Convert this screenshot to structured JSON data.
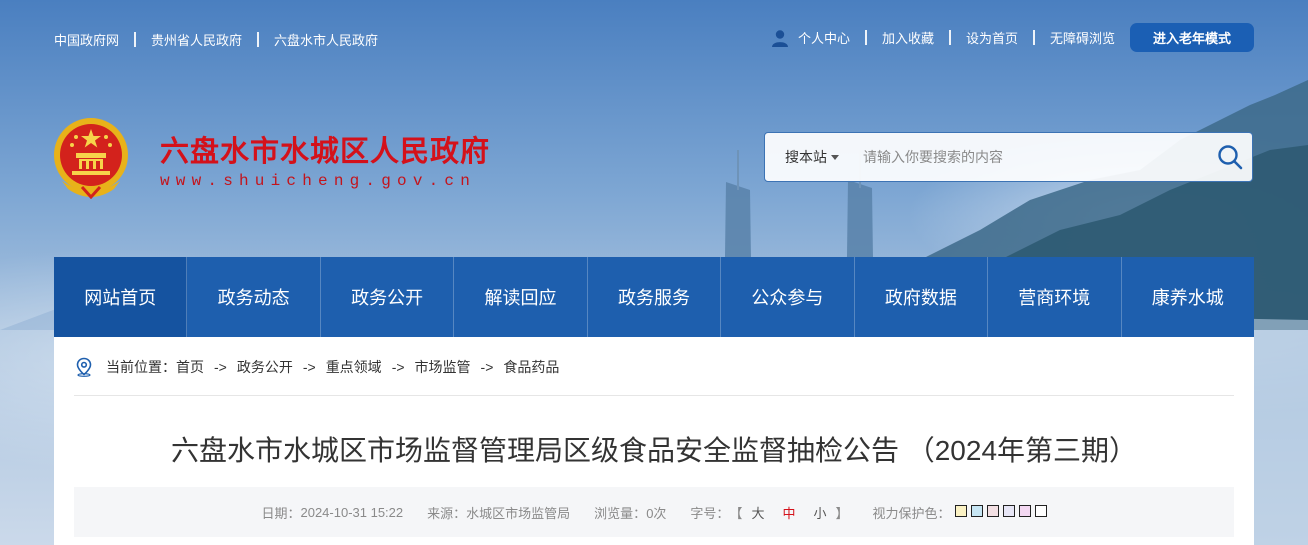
{
  "top_links": [
    "中国政府网",
    "贵州省人民政府",
    "六盘水市人民政府"
  ],
  "top_right": {
    "personal_center": "个人中心",
    "add_favorite": "加入收藏",
    "set_homepage": "设为首页",
    "accessibility": "无障碍浏览",
    "elder_mode": "进入老年模式"
  },
  "header": {
    "title": "六盘水市水城区人民政府",
    "url": "www.shuicheng.gov.cn"
  },
  "search": {
    "scope": "搜本站",
    "placeholder": "请输入你要搜索的内容"
  },
  "nav": [
    "网站首页",
    "政务动态",
    "政务公开",
    "解读回应",
    "政务服务",
    "公众参与",
    "政府数据",
    "营商环境",
    "康养水城"
  ],
  "breadcrumb": {
    "prefix": "当前位置：",
    "items": [
      "首页",
      "政务公开",
      "重点领域",
      "市场监管",
      "食品药品"
    ],
    "arrow": "->"
  },
  "article": {
    "title": "六盘水市水城区市场监督管理局区级食品安全监督抽检公告 （2024年第三期）",
    "date_label": "日期：",
    "date": "2024-10-31 15:22",
    "source_label": "来源：",
    "source": "水城区市场监管局",
    "views_label": "浏览量：",
    "views": "0次",
    "font_label": "字号：",
    "bracket_open": "【",
    "bracket_close": "】",
    "font_sizes": [
      "大",
      "中",
      "小"
    ],
    "eye_care_label": "视力保护色："
  },
  "colors": {
    "eye_care": [
      "#fbf2c4",
      "#c7e6f4",
      "#f3e0e4",
      "#e7e6f6",
      "#f3d8f2",
      "#ffffff"
    ],
    "brand_red": "#d4111a",
    "nav_blue": "#1e5fae"
  }
}
